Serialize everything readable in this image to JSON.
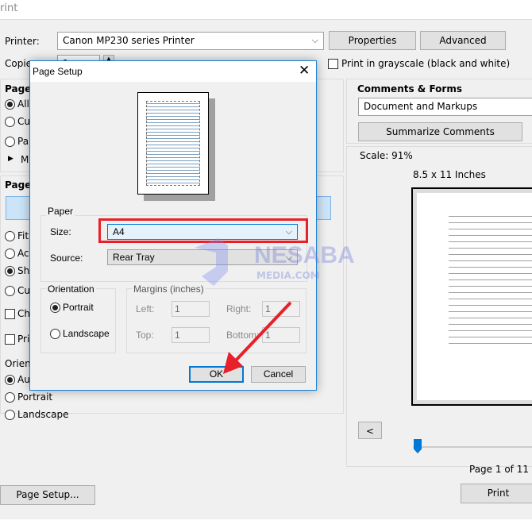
{
  "window": {
    "title": "rint"
  },
  "printer": {
    "label": "Printer:",
    "value": "Canon MP230 series Printer",
    "properties": "Properties",
    "advanced": "Advanced"
  },
  "copies": {
    "label": "Copie",
    "value": "1"
  },
  "grayscale": {
    "label": "Print in grayscale (black and white)",
    "checked": false
  },
  "pages": {
    "title": "Pages",
    "options": [
      "All",
      "Cu",
      "Pa"
    ],
    "more": "M"
  },
  "sizing": {
    "title": "Page :",
    "options": [
      "Fit",
      "Ac",
      "Shr",
      "Cu"
    ],
    "choose": "Ch"
  },
  "print_on_both": "Pri",
  "orientation": {
    "title": "Orient",
    "options": [
      "Au",
      "Portrait",
      "Landscape"
    ]
  },
  "page_setup_button": "Page Setup...",
  "comments": {
    "title": "Comments & Forms",
    "value": "Document and Markups",
    "summarize": "Summarize Comments"
  },
  "preview": {
    "scale": "Scale:  91%",
    "size": "8.5 x 11 Inches",
    "prev": "<",
    "page": "Page 1 of 11",
    "slider_fraction": 0.0
  },
  "print_button": "Print",
  "dialog": {
    "title": "Page Setup",
    "paper": {
      "title": "Paper",
      "size_label": "Size:",
      "size_value": "A4",
      "source_label": "Source:",
      "source_value": "Rear Tray"
    },
    "orientation": {
      "title": "Orientation",
      "portrait": "Portrait",
      "landscape": "Landscape",
      "selected": "Portrait"
    },
    "margins": {
      "title": "Margins (inches)",
      "left_label": "Left:",
      "left": "1",
      "right_label": "Right:",
      "right": "1",
      "top_label": "Top:",
      "top": "1",
      "bottom_label": "Bottom:",
      "bottom": "1"
    },
    "ok": "OK",
    "cancel": "Cancel"
  },
  "watermark": {
    "line1": "NESABA",
    "line2": "MEDIA.COM"
  },
  "colors": {
    "highlight": "#e8202a",
    "accent": "#0078d7"
  }
}
